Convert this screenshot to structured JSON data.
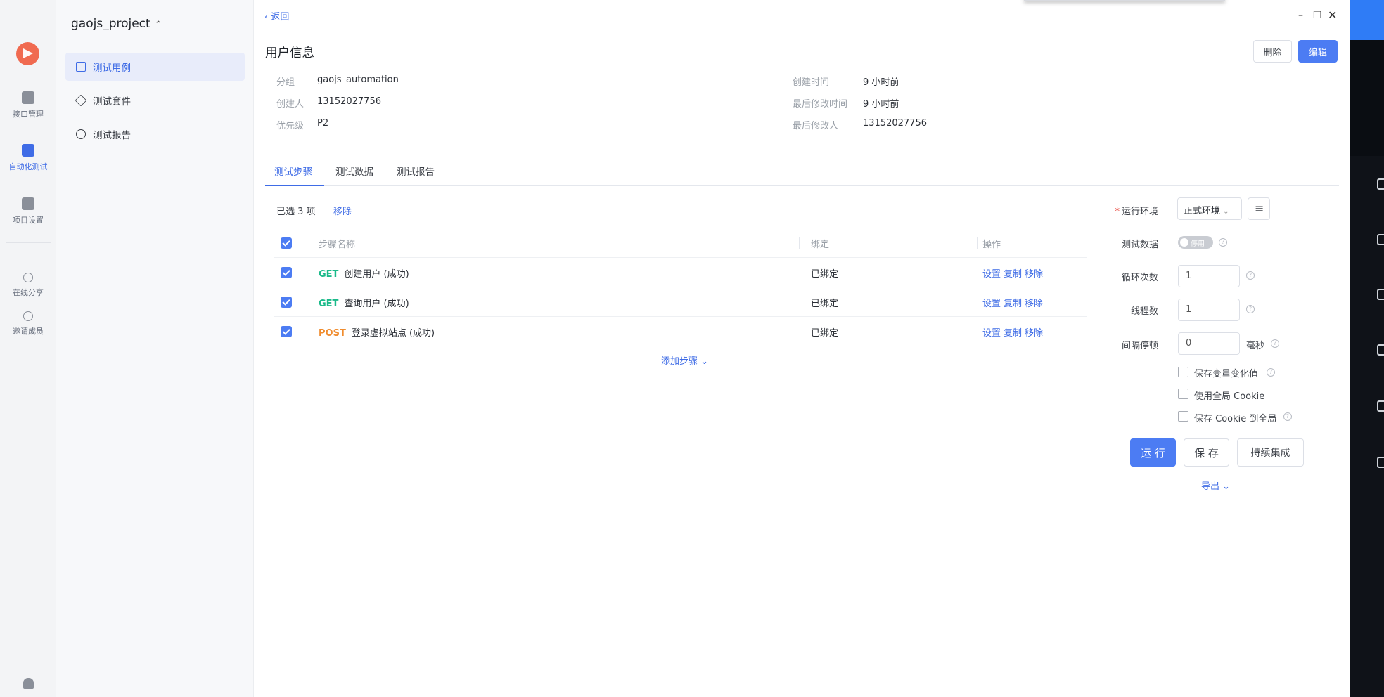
{
  "rail": {
    "items": [
      {
        "label": "接口管理"
      },
      {
        "label": "自动化测试"
      },
      {
        "label": "项目设置"
      },
      {
        "label": "在线分享"
      },
      {
        "label": "邀请成员"
      }
    ]
  },
  "sidebar": {
    "project": "gaojs_project",
    "items": [
      {
        "label": "测试用例"
      },
      {
        "label": "测试套件"
      },
      {
        "label": "测试报告"
      }
    ]
  },
  "header": {
    "back": "返回",
    "title": "用户信息",
    "delete_label": "删除",
    "edit_label": "编辑"
  },
  "meta": {
    "group_label": "分组",
    "group": "gaojs_automation",
    "creator_label": "创建人",
    "creator": "13152027756",
    "priority_label": "优先级",
    "priority": "P2",
    "created_label": "创建时间",
    "created": "9 小时前",
    "modified_label": "最后修改时间",
    "modified": "9 小时前",
    "modifier_label": "最后修改人",
    "modifier": "13152027756"
  },
  "tabs": [
    "测试步骤",
    "测试数据",
    "测试报告"
  ],
  "steps": {
    "selected_text": "已选 3 项",
    "remove_label": "移除",
    "columns": [
      "步骤名称",
      "绑定",
      "操作"
    ],
    "rows": [
      {
        "method": "GET",
        "name": "创建用户 (成功)",
        "bind": "已绑定",
        "method_color": "#1aba8a"
      },
      {
        "method": "GET",
        "name": "查询用户 (成功)",
        "bind": "已绑定",
        "method_color": "#1aba8a"
      },
      {
        "method": "POST",
        "name": "登录虚拟站点 (成功)",
        "bind": "已绑定",
        "method_color": "#f08c2e"
      }
    ],
    "ops": [
      "设置",
      "复制",
      "移除"
    ],
    "add_step": "添加步骤 ⌄"
  },
  "settings": {
    "env_label": "运行环境",
    "env_value": "正式环境",
    "data_label": "测试数据",
    "data_toggle": "停用",
    "loops_label": "循环次数",
    "loops": "1",
    "threads_label": "线程数",
    "threads": "1",
    "interval_label": "间隔停顿",
    "interval": "0",
    "interval_unit": "毫秒",
    "options": [
      "保存变量变化值",
      "使用全局 Cookie",
      "保存 Cookie 到全局"
    ],
    "run_label": "运 行",
    "save_label": "保 存",
    "ci_label": "持续集成",
    "export_label": "导出 ⌄"
  },
  "colors": {
    "accent": "#4c7cf3",
    "get": "#1aba8a",
    "post": "#f08c2e"
  }
}
